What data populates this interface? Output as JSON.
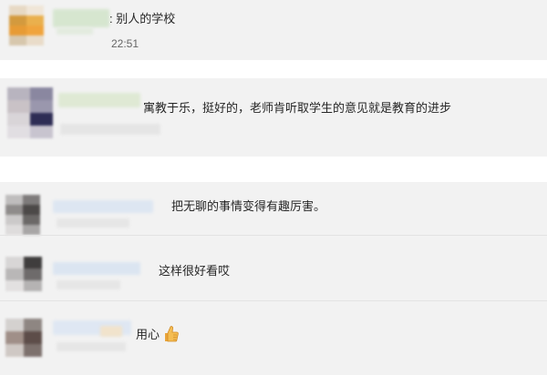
{
  "comments": [
    {
      "text": ": 别人的学校",
      "time": "22:51"
    },
    {
      "text": "寓教于乐，挺好的，老师肯听取学生的意见就是教育的进步"
    },
    {
      "text": "把无聊的事情变得有趣厉害。"
    },
    {
      "text": "这样很好看哎"
    },
    {
      "text": "用心",
      "emoji": "thumbs-up-icon"
    }
  ],
  "colors": {
    "card_bg": "#f2f2f2",
    "page_bg": "#ffffff",
    "text": "#262626",
    "time": "#666666"
  }
}
